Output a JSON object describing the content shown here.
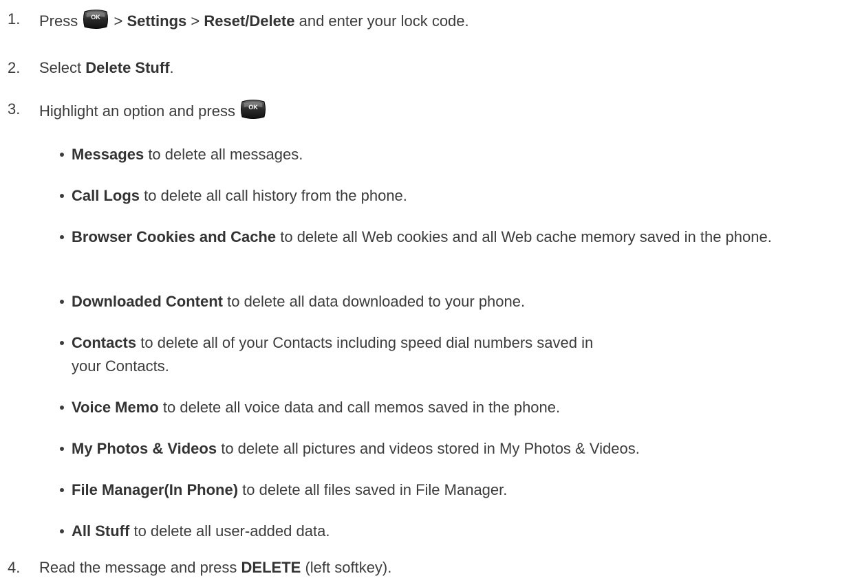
{
  "ok_key": {
    "label": "OK",
    "icon": "ok-key-icon"
  },
  "steps": [
    {
      "number": "1.",
      "before_icon": "Press",
      "separator1": ">",
      "settings": "Settings",
      "separator2": ">",
      "reset_delete": "Reset/Delete",
      "after": "and enter your lock code."
    },
    {
      "number": "2.",
      "before": "Select",
      "bold": "Delete Stuff",
      "after": "."
    },
    {
      "number": "3.",
      "before_icon": "Highlight an option and press"
    },
    {
      "number": "4.",
      "before": "Read the message and press",
      "bold": "DELETE",
      "after": "(left softkey)."
    }
  ],
  "options": [
    {
      "bold": "Messages",
      "text": "to delete all messages."
    },
    {
      "bold": "Call Logs",
      "text": "to delete all call history from the phone."
    },
    {
      "bold": "Browser Cookies and Cache",
      "text": "to delete all Web cookies and all Web cache memory saved in the phone."
    },
    {
      "bold": "Downloaded Content",
      "text": "to delete all data downloaded to your phone."
    },
    {
      "bold": "Contacts",
      "text": "to delete all of your Contacts including speed dial numbers saved in your Contacts."
    },
    {
      "bold": "Voice Memo",
      "text": "to delete all voice data and call memos saved in the phone."
    },
    {
      "bold": "My Photos & Videos",
      "text": "to delete all pictures and videos stored in My Photos & Videos."
    },
    {
      "bold": "File Manager(In Phone)",
      "text": "to delete all files saved in File Manager."
    },
    {
      "bold": "All Stuff",
      "text": "to delete all user-added data."
    }
  ]
}
